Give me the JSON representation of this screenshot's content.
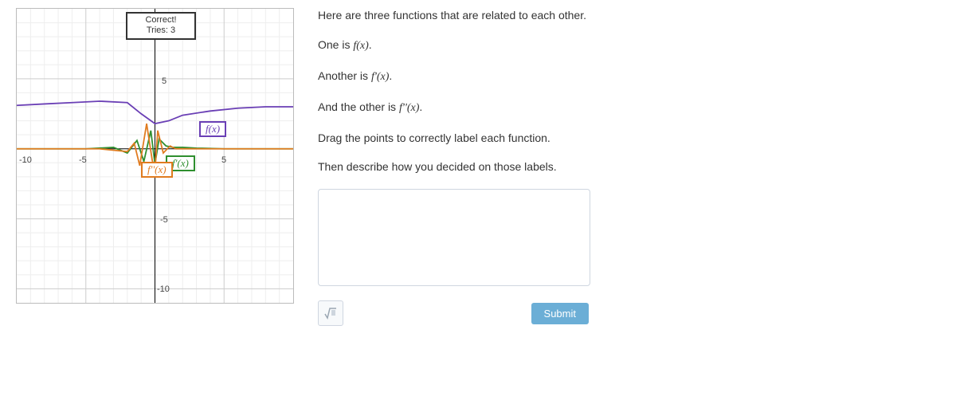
{
  "status": {
    "line1": "Correct!",
    "line2": "Tries: 3"
  },
  "chart_data": {
    "type": "line",
    "xlabel": "",
    "ylabel": "",
    "xlim": [
      -10,
      10
    ],
    "ylim": [
      -10,
      10
    ],
    "x_ticks": [
      -10,
      -5,
      0,
      5,
      10
    ],
    "y_ticks": [
      -10,
      -5,
      0,
      5,
      10
    ],
    "series": [
      {
        "name": "f(x)",
        "color": "#6a3fb5",
        "x": [
          -10,
          -8,
          -6,
          -4,
          -2,
          -1,
          0,
          1,
          2,
          4,
          6,
          8,
          10
        ],
        "y": [
          3.1,
          3.2,
          3.3,
          3.4,
          3.3,
          2.5,
          1.8,
          2.0,
          2.4,
          2.7,
          2.9,
          3.0,
          3.0
        ]
      },
      {
        "name": "f'(x)",
        "color": "#2f8f2f",
        "x": [
          -10,
          -5,
          -3,
          -2,
          -1.3,
          -0.8,
          -0.3,
          0,
          0.3,
          0.8,
          1.3,
          2,
          3,
          5,
          10
        ],
        "y": [
          0,
          0,
          0.1,
          -0.3,
          0.6,
          -0.9,
          1.3,
          -1.1,
          0.7,
          0.2,
          0.1,
          0.1,
          0.05,
          0,
          0
        ]
      },
      {
        "name": "f''(x)",
        "color": "#e07b1f",
        "x": [
          -10,
          -4,
          -2,
          -1.5,
          -1.1,
          -0.6,
          -0.2,
          0,
          0.2,
          0.6,
          1.1,
          1.5,
          2,
          4,
          10
        ],
        "y": [
          0,
          0,
          -0.2,
          0.4,
          -1.2,
          1.8,
          -0.8,
          -1.6,
          1.3,
          -0.3,
          0.2,
          0,
          0,
          0,
          0
        ]
      }
    ],
    "draggable_labels": [
      {
        "text": "f(x)",
        "series": "f(x)"
      },
      {
        "text": "f'(x)",
        "series": "f'(x)"
      },
      {
        "text": "f''(x)",
        "series": "f''(x)"
      }
    ]
  },
  "ticks": {
    "xm10": "-10",
    "xm5": "-5",
    "x5": "5",
    "y5": "5",
    "ym5": "-5",
    "ym10": "-10"
  },
  "labels": {
    "f": "f(x)",
    "fprime": "f'(x)",
    "fdouble": "f''(x)"
  },
  "narrative": {
    "p1a": "Here are three functions that are related to each other.",
    "p2a": "One is ",
    "p2m": "f(x)",
    "p2b": ".",
    "p3a": "Another is ",
    "p3m": "f'(x)",
    "p3b": ".",
    "p4a": "And the other is ",
    "p4m": "f''(x)",
    "p4b": ".",
    "p5": "Drag the points to correctly label each function.",
    "p6": "Then describe how you decided on those labels."
  },
  "buttons": {
    "submit": "Submit"
  }
}
